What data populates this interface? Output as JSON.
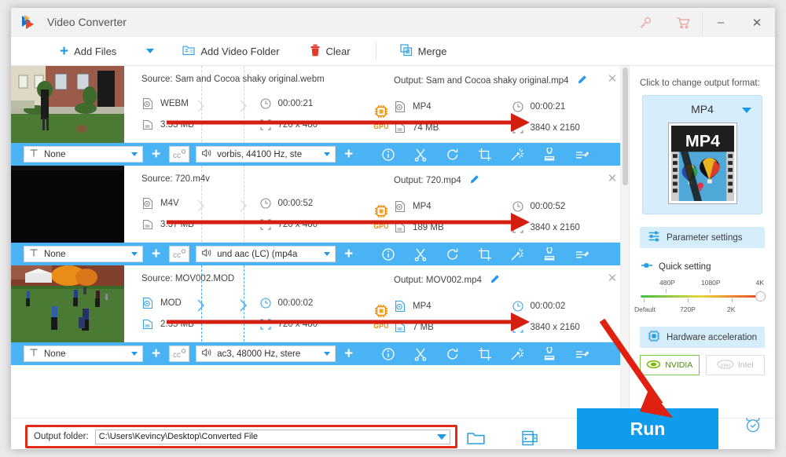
{
  "window": {
    "title": "Video Converter",
    "logo_icon": "app-logo-icon",
    "key_icon": "key-icon",
    "cart_icon": "cart-icon",
    "minimize_label": "–",
    "close_label": "✕"
  },
  "toolbar": {
    "add_files": "Add Files",
    "add_files_caret_icon": "chevron-down-icon",
    "add_video_folder": "Add Video Folder",
    "clear": "Clear",
    "merge": "Merge"
  },
  "files": [
    {
      "source_label": "Source: Sam and Cocoa shaky original.webm",
      "source_format": "WEBM",
      "source_duration": "00:00:21",
      "source_size": "3.53 MB",
      "source_resolution": "720 x 480",
      "output_label": "Output: Sam and Cocoa shaky original.mp4",
      "output_format": "MP4",
      "output_duration": "00:00:21",
      "output_size": "74 MB",
      "output_resolution": "3840 x 2160",
      "gpu_badge": "GPU",
      "subtitle": "None",
      "audio": "vorbis, 44100 Hz, ste",
      "thumb": "house-lawn-dog"
    },
    {
      "source_label": "Source: 720.m4v",
      "source_format": "M4V",
      "source_duration": "00:00:52",
      "source_size": "3.37 MB",
      "source_resolution": "720 x 480",
      "output_label": "Output: 720.mp4",
      "output_format": "MP4",
      "output_duration": "00:00:52",
      "output_size": "189 MB",
      "output_resolution": "3840 x 2160",
      "gpu_badge": "GPU",
      "subtitle": "None",
      "audio": "und aac (LC) (mp4a",
      "thumb": "dark-frame"
    },
    {
      "source_label": "Source: MOV002.MOD",
      "source_format": "MOD",
      "source_duration": "00:00:02",
      "source_size": "2.35 MB",
      "source_resolution": "720 x 480",
      "output_label": "Output: MOV002.mp4",
      "output_format": "MP4",
      "output_duration": "00:00:02",
      "output_size": "7 MB",
      "output_resolution": "3840 x 2160",
      "gpu_badge": "GPU",
      "subtitle": "None",
      "audio": "ac3, 48000 Hz, stere",
      "thumb": "soccer-field"
    }
  ],
  "row_icons": {
    "info": "info-icon",
    "cut": "scissors-icon",
    "rotate": "rotate-icon",
    "crop": "crop-icon",
    "effect": "magic-wand-icon",
    "watermark": "stamp-icon",
    "subtitle": "subtitle-edit-icon",
    "add_subtitle": "plus-icon",
    "add_audio": "plus-icon",
    "cc": "cc-icon",
    "speaker": "speaker-icon",
    "text": "text-icon",
    "close": "close-icon",
    "pencil": "pencil-icon"
  },
  "right_panel": {
    "title": "Click to change output format:",
    "format_name": "MP4",
    "format_caret_icon": "chevron-down-icon",
    "format_thumb_text": "MP4",
    "parameter_settings": "Parameter settings",
    "parameter_settings_icon": "sliders-icon",
    "quick_setting": "Quick setting",
    "quick_setting_icon": "toggle-icon",
    "slider_top_labels": [
      "480P",
      "1080P",
      "4K"
    ],
    "slider_bottom_labels": [
      "Default",
      "720P",
      "2K"
    ],
    "slider_value": "4K",
    "hardware_acceleration": "Hardware acceleration",
    "hardware_acceleration_icon": "chip-icon",
    "gpu_options": [
      {
        "label": "NVIDIA",
        "icon": "nvidia-icon",
        "state": "active"
      },
      {
        "label": "Intel",
        "icon": "intel-icon",
        "state": "disabled"
      }
    ]
  },
  "bottom": {
    "output_folder_label": "Output folder:",
    "output_folder_value": "C:\\Users\\Kevincy\\Desktop\\Converted File",
    "output_caret_icon": "chevron-down-icon",
    "open_folder_icon": "folder-icon",
    "media_icon": "media-library-icon",
    "run_label": "Run",
    "alarm_icon": "alarm-clock-icon"
  },
  "colors": {
    "accent_blue": "#0f9cec",
    "bar_blue": "#4ab3f4",
    "panel_blue": "#d6eefb",
    "annotation_red": "#e12b16",
    "gpu_orange": "#f08a00"
  }
}
